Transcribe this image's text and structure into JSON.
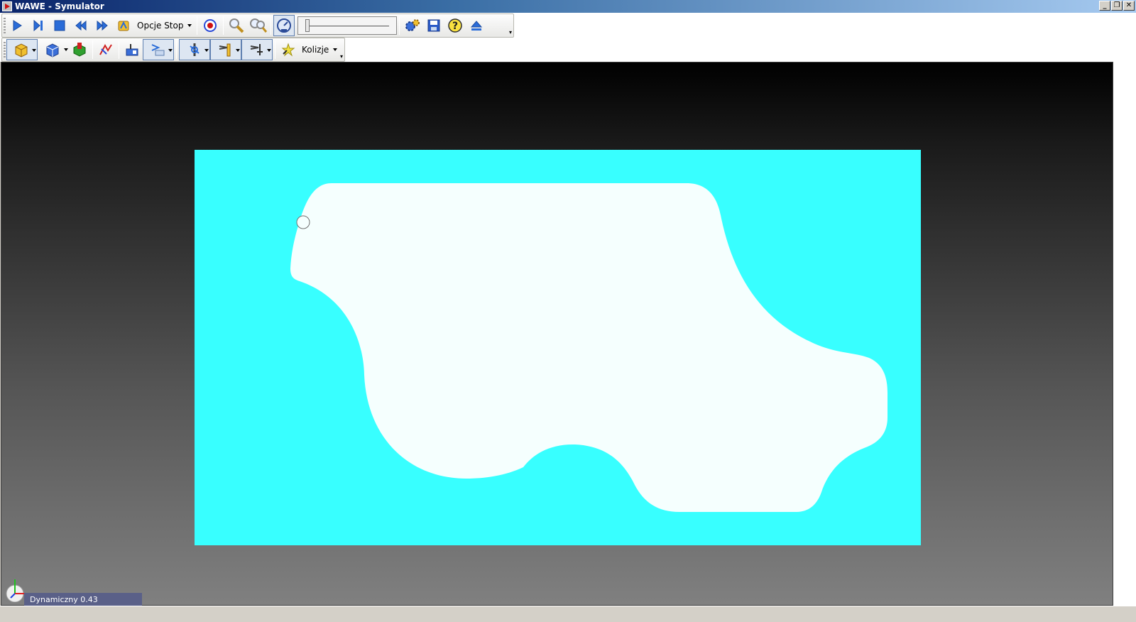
{
  "window": {
    "title": "WAWE - Symulator",
    "controls": [
      "_",
      "❐",
      "✕"
    ]
  },
  "toolbar1": {
    "items": [
      {
        "name": "play-button",
        "icon": "play-icon"
      },
      {
        "name": "step-button",
        "icon": "step-icon"
      },
      {
        "name": "stop-button",
        "icon": "stop-icon"
      },
      {
        "name": "rewind-button",
        "icon": "rewind-icon"
      },
      {
        "name": "fast-forward-button",
        "icon": "fast-forward-icon"
      },
      {
        "name": "stop-options-button",
        "icon": "stop-options-icon"
      }
    ],
    "stop_options_label": "Opcje Stop",
    "record_icon": "record-icon",
    "zoom_icon": "zoom-icon",
    "zoom_fit_icon": "zoom-fit-icon",
    "speed_icon": "speed-gauge-icon",
    "settings_icon": "settings-icon",
    "save_icon": "save-icon",
    "help_icon": "help-icon",
    "eject_icon": "eject-icon"
  },
  "toolbar2": {
    "collisions_label": "Kolizje"
  },
  "viewport": {
    "background_top": "#000000",
    "background_bottom": "#808080",
    "stock_color": "#38ffff",
    "part_color": "#f5fffe"
  },
  "status": {
    "text": "Dynamiczny 0.43"
  }
}
